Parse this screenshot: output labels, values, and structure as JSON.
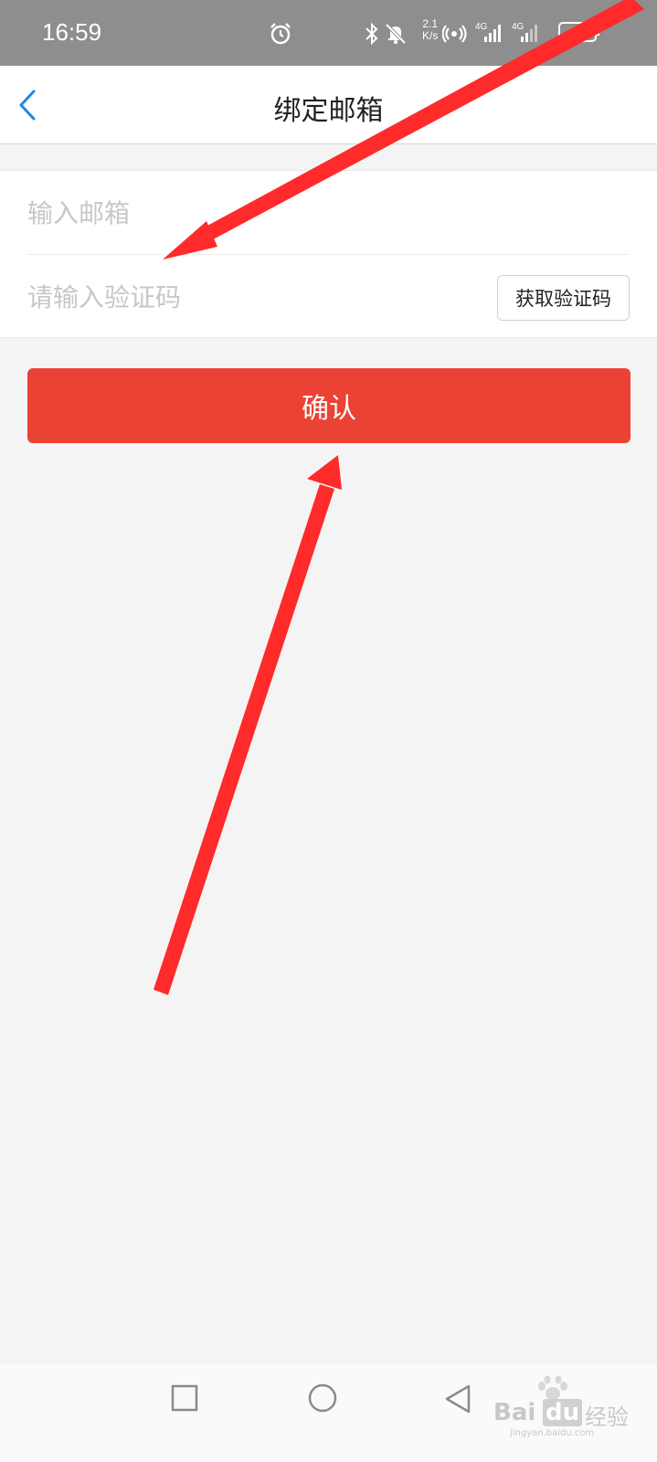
{
  "status_bar": {
    "time": "16:59",
    "speed_value": "2.1",
    "speed_unit": "K/s",
    "signal_1": "4G",
    "signal_2": "4G",
    "battery": "53"
  },
  "nav": {
    "title": "绑定邮箱"
  },
  "form": {
    "email_placeholder": "输入邮箱",
    "code_placeholder": "请输入验证码",
    "get_code_label": "获取验证码"
  },
  "confirm_label": "确认",
  "watermark": {
    "brand": "Bai",
    "brand_du": "du",
    "brand_cn": "经验",
    "url": "jingyan.baidu.com"
  },
  "colors": {
    "accent_blue": "#1e88e5",
    "confirm_red": "#ea4335",
    "arrow_red": "#ff2a2a"
  }
}
